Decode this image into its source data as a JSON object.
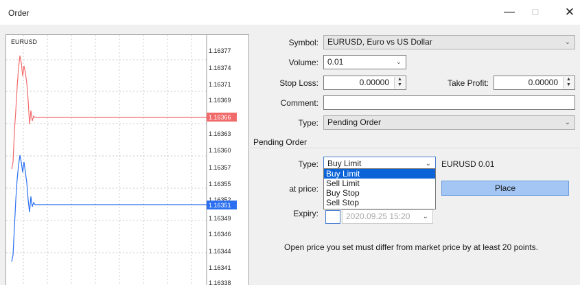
{
  "window": {
    "title": "Order",
    "minimize": "—",
    "maximize": "☐",
    "close": "✕"
  },
  "chart": {
    "symbol": "EURUSD",
    "ticks": [
      "1.16377",
      "1.16374",
      "1.16371",
      "1.16369",
      "1.16366",
      "1.16363",
      "1.16360",
      "1.16357",
      "1.16355",
      "1.16352",
      "1.16351",
      "1.16349",
      "1.16346",
      "1.16344",
      "1.16341",
      "1.16338"
    ],
    "bid_label": "1.16366",
    "ask_label": "1.16351",
    "bid_color": "#f26b6b",
    "ask_color": "#2a6ff0"
  },
  "form": {
    "symbol_label": "Symbol:",
    "symbol_value": "EURUSD, Euro vs US Dollar",
    "volume_label": "Volume:",
    "volume_value": "0.01",
    "stoploss_label": "Stop Loss:",
    "stoploss_value": "0.00000",
    "takeprofit_label": "Take Profit:",
    "takeprofit_value": "0.00000",
    "comment_label": "Comment:",
    "comment_value": "",
    "type_label": "Type:",
    "type_value": "Pending Order"
  },
  "pending": {
    "group_title": "Pending Order",
    "type_label": "Type:",
    "type_value": "Buy Limit",
    "summary": "EURUSD 0.01",
    "options": [
      "Buy Limit",
      "Sell Limit",
      "Buy Stop",
      "Sell Stop"
    ],
    "price_label": "at price:",
    "expiry_label": "Expiry:",
    "expiry_value": "2020.09.25 15:20",
    "place_button": "Place",
    "note": "Open price you set must differ from market price by at least 20 points."
  }
}
